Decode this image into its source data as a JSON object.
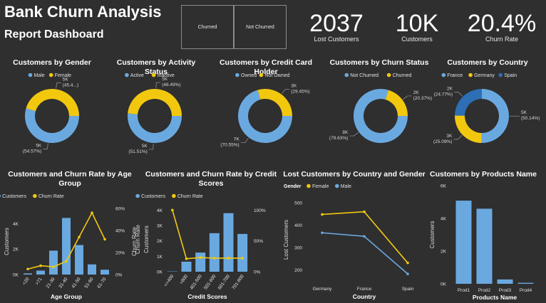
{
  "header": {
    "title": "Bank Churn Analysis",
    "subtitle": "Report Dashboard",
    "slicer_buttons": [
      "Churned",
      "Not Churned"
    ]
  },
  "kpis": [
    {
      "value": "2037",
      "label": "Lost Customers"
    },
    {
      "value": "10K",
      "label": "Customers"
    },
    {
      "value": "20.4%",
      "label": "Churn Rate"
    }
  ],
  "colors": {
    "blue": "#6aa9e0",
    "yellow": "#f2c80f",
    "darkblue": "#2c6fb4",
    "background": "#2f2f2f"
  },
  "chart_data": [
    {
      "type": "pie",
      "title": "Customers by Gender",
      "legend": [
        "Male",
        "Female"
      ],
      "slices": [
        {
          "name": "Male",
          "value": 54.57,
          "label": "5K\n(54.57%)",
          "color": "#6aa9e0"
        },
        {
          "name": "Female",
          "value": 45.43,
          "label": "5K\n(45.4...)",
          "color": "#f2c80f"
        }
      ]
    },
    {
      "type": "pie",
      "title": "Customers by Activity Status",
      "legend": [
        "Active",
        "Inactive"
      ],
      "slices": [
        {
          "name": "Active",
          "value": 51.51,
          "label": "5K\n(51.51%)",
          "color": "#6aa9e0"
        },
        {
          "name": "Inactive",
          "value": 48.49,
          "label": "5K\n(48.49%)",
          "color": "#f2c80f"
        }
      ]
    },
    {
      "type": "pie",
      "title": "Customers by Credit Card Holder",
      "legend": [
        "Owned",
        "Not Owned"
      ],
      "slices": [
        {
          "name": "Owned",
          "value": 70.55,
          "label": "7K\n(70.55%)",
          "color": "#6aa9e0"
        },
        {
          "name": "Not Owned",
          "value": 29.45,
          "label": "3K\n(29.45%)",
          "color": "#f2c80f"
        }
      ]
    },
    {
      "type": "pie",
      "title": "Customers by Churn Status",
      "legend": [
        "Not Churned",
        "Churned"
      ],
      "slices": [
        {
          "name": "Not Churned",
          "value": 79.63,
          "label": "8K\n(79.63%)",
          "color": "#6aa9e0"
        },
        {
          "name": "Churned",
          "value": 20.37,
          "label": "2K\n(20.37%)",
          "color": "#f2c80f"
        }
      ]
    },
    {
      "type": "pie",
      "title": "Customers by Country",
      "legend": [
        "France",
        "Germany",
        "Spain"
      ],
      "slices": [
        {
          "name": "France",
          "value": 50.14,
          "label": "5K\n(50.14%)",
          "color": "#6aa9e0"
        },
        {
          "name": "Germany",
          "value": 25.09,
          "label": "3K\n(25.09%)",
          "color": "#f2c80f"
        },
        {
          "name": "Spain",
          "value": 24.77,
          "label": "2K\n(24.77%)",
          "color": "#2c6fb4"
        }
      ]
    },
    {
      "type": "bar",
      "title": "Customers and Churn Rate by Age Group",
      "legend": [
        "Customers",
        "Churn Rate"
      ],
      "categories": [
        "<20",
        ">71",
        "21-30",
        "31-40",
        "41-50",
        "51-60",
        "61-70"
      ],
      "series": [
        {
          "name": "Customers",
          "type": "bar",
          "values": [
            89,
            310,
            1880,
            4450,
            2320,
            800,
            380
          ]
        },
        {
          "name": "Churn Rate",
          "type": "line",
          "values": [
            5,
            8,
            7,
            12,
            34,
            56,
            32
          ]
        }
      ],
      "xlabel": "Age Group",
      "ylabel": "Customers",
      "ylabel2": "Churn Rate",
      "yticks": [
        "0K",
        "2K",
        "4K"
      ],
      "ylim": [
        0,
        5200
      ],
      "y2ticks": [
        "0%",
        "20%",
        "40%",
        "60%"
      ],
      "y2lim": [
        0,
        60
      ]
    },
    {
      "type": "bar",
      "title": "Customers and Churn Rate by Credit Scores",
      "legend": [
        "Customers",
        "Churn Rate"
      ],
      "categories": [
        "<=400",
        ">800",
        "401-500",
        "501-600",
        "601-700",
        "701-800"
      ],
      "series": [
        {
          "name": "Customers",
          "type": "bar",
          "values": [
            20,
            650,
            1240,
            2500,
            3800,
            2450
          ]
        },
        {
          "name": "Churn Rate",
          "type": "line",
          "values": [
            100,
            21,
            23,
            22,
            22,
            22
          ]
        }
      ],
      "xlabel": "Credit Scores",
      "ylabel": "Customers",
      "ylabel2": "Churn Rate",
      "yticks": [
        "0K",
        "1K",
        "2K",
        "3K",
        "4K"
      ],
      "ylim": [
        0,
        4200
      ],
      "y2ticks": [
        "0%",
        "50%",
        "100%"
      ],
      "y2lim": [
        0,
        105
      ]
    },
    {
      "type": "line",
      "title": "Lost Customers by Country and Gender",
      "legend_title": "Gender",
      "legend": [
        "Female",
        "Male"
      ],
      "categories": [
        "Germany",
        "France",
        "Spain"
      ],
      "series": [
        {
          "name": "Female",
          "values": [
            448,
            460,
            231
          ],
          "color": "#f2c80f"
        },
        {
          "name": "Male",
          "values": [
            366,
            350,
            182
          ],
          "color": "#6aa9e0"
        }
      ],
      "xlabel": "Country",
      "ylabel": "Lost Customers",
      "yticks": [
        "200",
        "300",
        "400",
        "500"
      ],
      "ylim": [
        160,
        510
      ]
    },
    {
      "type": "bar",
      "title": "Customers by Products Name",
      "categories": [
        "Prod1",
        "Prod2",
        "Prod3",
        "Prod4"
      ],
      "values": [
        5084,
        4590,
        266,
        60
      ],
      "xlabel": "Products Name",
      "ylabel": "Customers",
      "yticks": [
        "0K",
        "2K",
        "4K",
        "6K"
      ],
      "ylim": [
        0,
        6000
      ]
    }
  ]
}
